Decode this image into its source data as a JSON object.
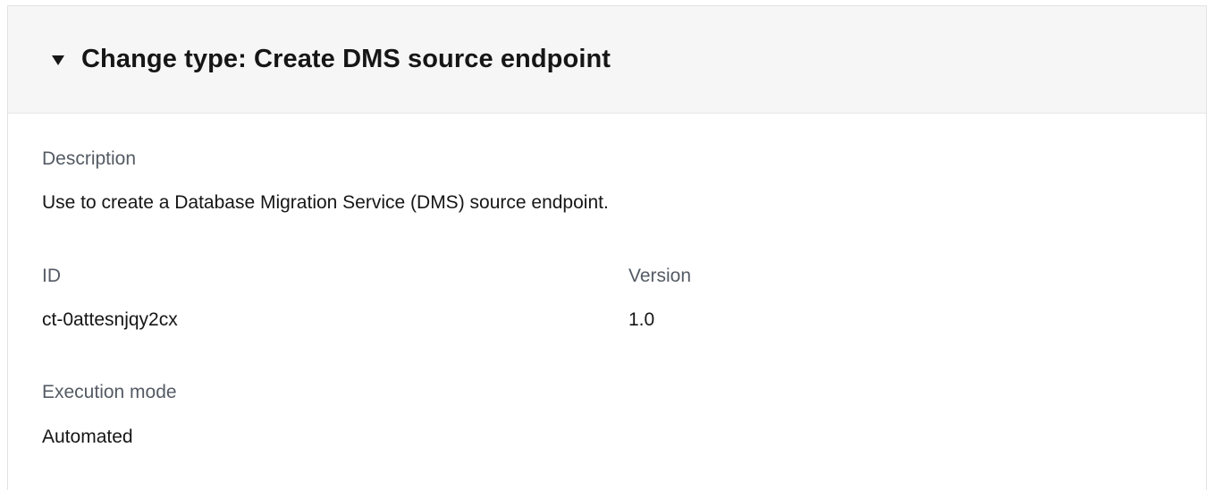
{
  "header": {
    "title": "Change type: Create DMS source endpoint",
    "toggle_icon": "caret-down-icon"
  },
  "details": {
    "description_label": "Description",
    "description_value": "Use to create a Database Migration Service (DMS) source endpoint.",
    "id_label": "ID",
    "id_value": "ct-0attesnjqy2cx",
    "version_label": "Version",
    "version_value": "1.0",
    "execution_mode_label": "Execution mode",
    "execution_mode_value": "Automated"
  },
  "colors": {
    "header_bg": "#f6f6f6",
    "label_text": "#545b64",
    "value_text": "#161616"
  }
}
